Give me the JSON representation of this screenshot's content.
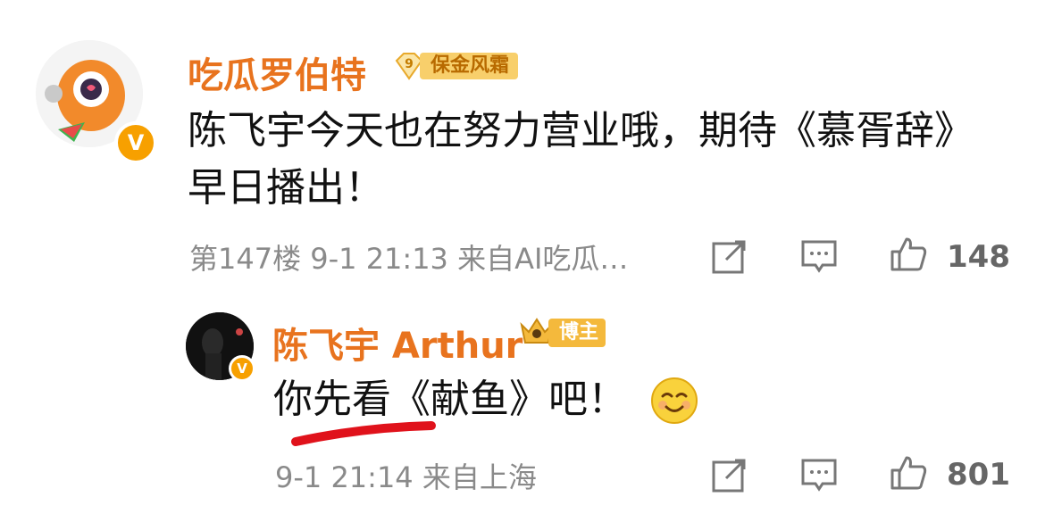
{
  "comment": {
    "username": "吃瓜罗伯特",
    "fan_level": "9",
    "fan_badge": "保金风霜",
    "verified_mark": "V",
    "text_line1": "陈飞宇今天也在努力营业哦，期待《慕胥辞》",
    "text_line2": "早日播出！",
    "meta": "第147楼  9-1 21:13  来自AI吃瓜…",
    "like_count": "148",
    "icons": [
      "share-icon",
      "comment-icon",
      "like-icon"
    ]
  },
  "reply": {
    "username": "陈飞宇 Arthur",
    "host_badge": "博主",
    "verified_mark": "V",
    "text": "你先看《献鱼》吧！",
    "meta": "9-1 21:14  来自上海",
    "like_count": "801",
    "emoji": "smile-emoji"
  },
  "colors": {
    "username": "#e8731e",
    "meta": "#8a8a8a",
    "badge_orange": "#f7a000",
    "underline_red": "#e0121b"
  }
}
